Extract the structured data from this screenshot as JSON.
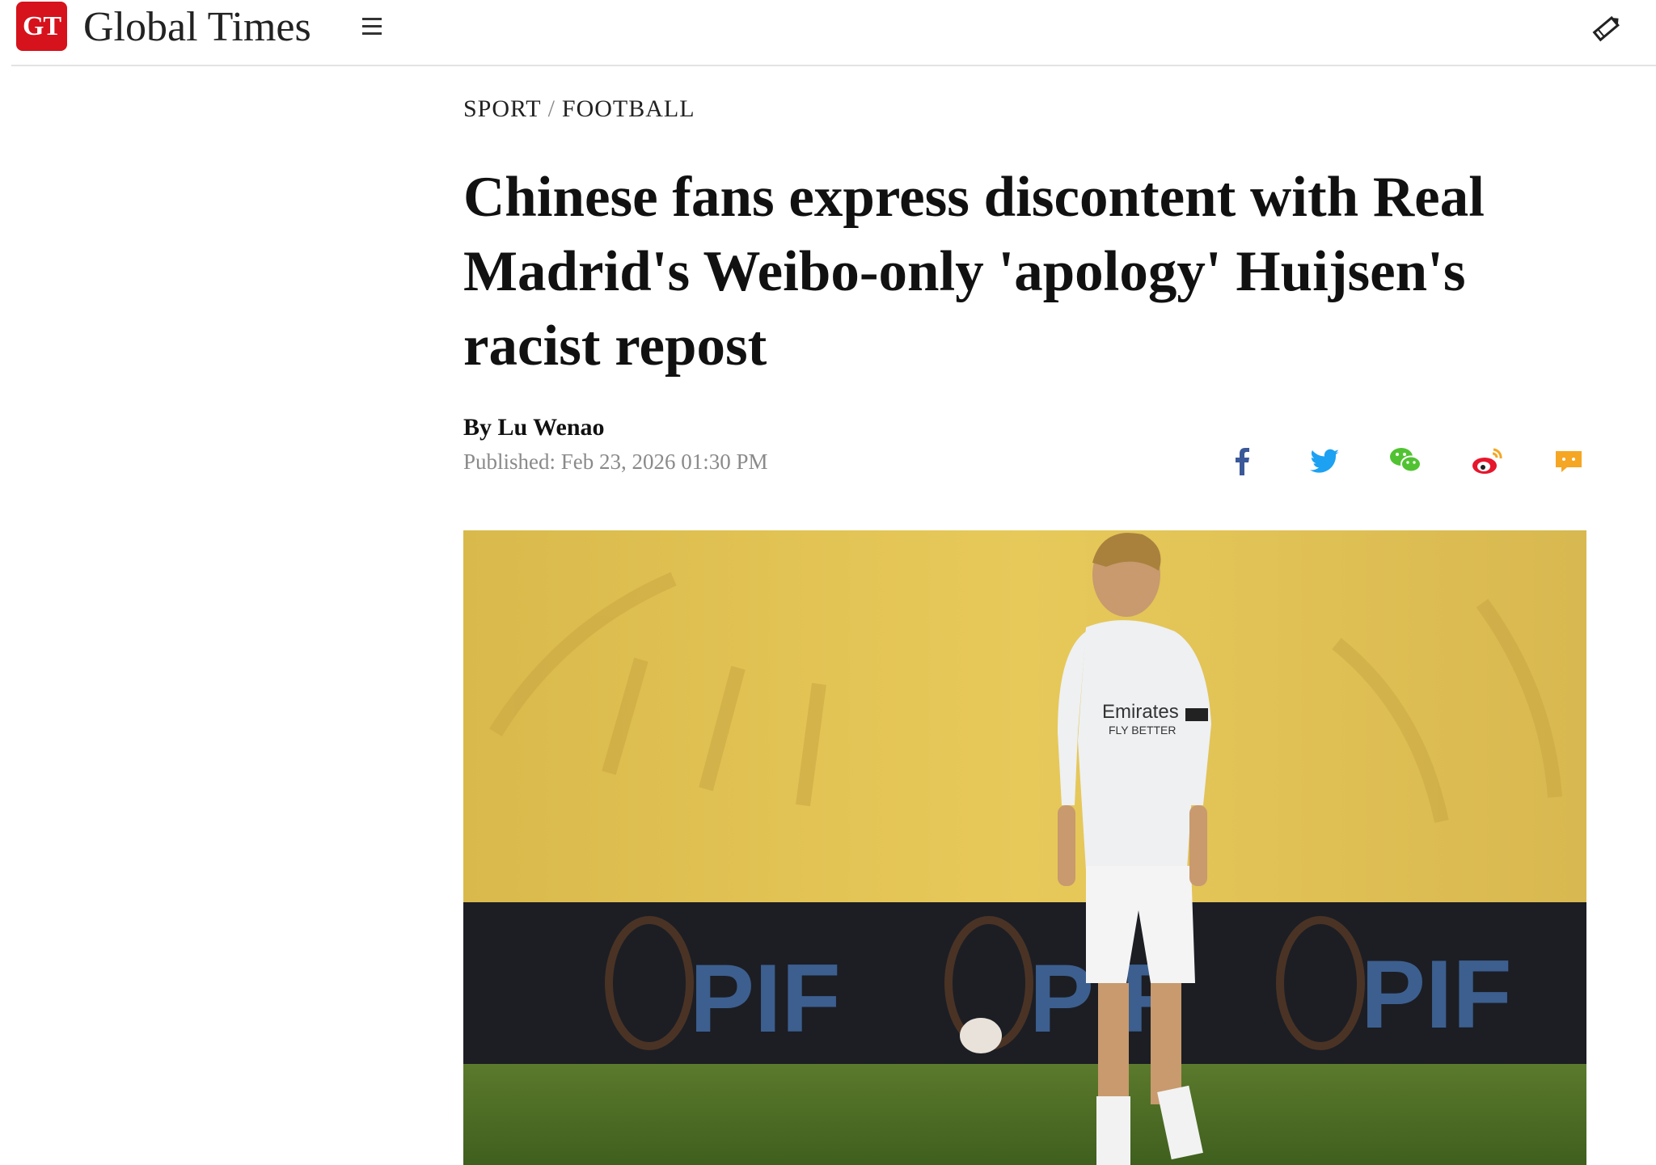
{
  "header": {
    "logo_badge": "GT",
    "logo_text": "Global Times",
    "menu_icon": "hamburger-menu-icon",
    "edit_icon": "pencil-icon"
  },
  "article": {
    "breadcrumb": [
      "SPORT",
      "FOOTBALL"
    ],
    "breadcrumb_separator": "/",
    "headline": "Chinese fans express discontent with Real Madrid's Weibo-only 'apology' Huijsen's racist repost",
    "byline": "By Lu Wenao",
    "published": "Published: Feb 23, 2026 01:30 PM",
    "share_icons": [
      "facebook-icon",
      "twitter-icon",
      "wechat-icon",
      "weibo-icon",
      "comment-icon"
    ],
    "photo": {
      "description_icon": "football-player-photo",
      "billboard_text": [
        "PIF",
        "PIF",
        "PIF"
      ],
      "shirt_text": [
        "Emirates",
        "FLY BETTER"
      ]
    }
  },
  "colors": {
    "brand_red": "#d6121c",
    "facebook": "#3b5998",
    "twitter": "#1da1f2",
    "wechat": "#51c332",
    "weibo": "#e6162d",
    "comment": "#f5a623"
  }
}
